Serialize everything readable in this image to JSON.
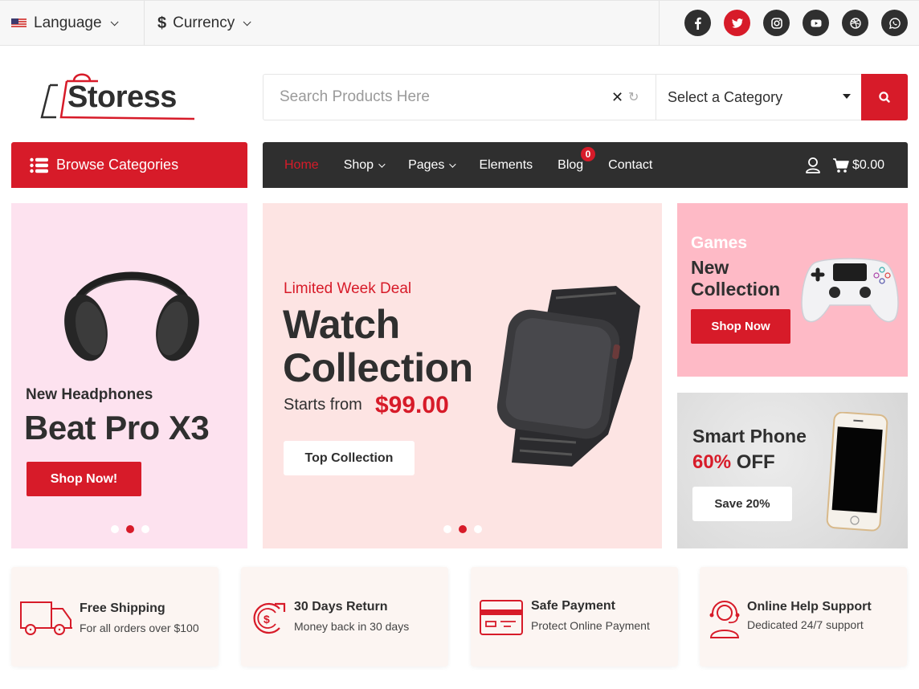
{
  "topbar": {
    "language_label": "Language",
    "currency_label": "Currency",
    "currency_symbol": "$",
    "socials": [
      {
        "name": "facebook",
        "icon": "facebook-icon"
      },
      {
        "name": "twitter",
        "icon": "twitter-icon",
        "active": true
      },
      {
        "name": "instagram",
        "icon": "instagram-icon"
      },
      {
        "name": "youtube",
        "icon": "youtube-icon"
      },
      {
        "name": "dribbble",
        "icon": "dribbble-icon"
      },
      {
        "name": "whatsapp",
        "icon": "whatsapp-icon"
      }
    ]
  },
  "header": {
    "logo_text": "Storess",
    "search": {
      "placeholder": "Search Products Here",
      "value": "",
      "clear_glyph": "✕",
      "refresh_glyph": "↻"
    },
    "category_select": {
      "selected": "Select a Category"
    }
  },
  "nav": {
    "browse_label": "Browse Categories",
    "links": [
      {
        "label": "Home",
        "active": true,
        "dropdown": false
      },
      {
        "label": "Shop",
        "active": false,
        "dropdown": true
      },
      {
        "label": "Pages",
        "active": false,
        "dropdown": true
      },
      {
        "label": "Elements",
        "active": false,
        "dropdown": false
      },
      {
        "label": "Blog",
        "active": false,
        "dropdown": false
      },
      {
        "label": "Contact",
        "active": false,
        "dropdown": false
      }
    ],
    "cart_count": "0",
    "cart_total": "$0.00"
  },
  "banners": {
    "left": {
      "subtitle": "New Headphones",
      "title": "Beat Pro X3",
      "button": "Shop Now!",
      "slides": 3,
      "active_slide": 2
    },
    "middle": {
      "subtitle": "Limited Week Deal",
      "title_line1": "Watch",
      "title_line2": "Collection",
      "price_prefix": "Starts from",
      "price": "$99.00",
      "button": "Top Collection",
      "slides": 3,
      "active_slide": 2
    },
    "top_right": {
      "subtitle": "Games",
      "title_line1": "New",
      "title_line2": "Collection",
      "button": "Shop Now"
    },
    "bottom_right": {
      "title": "Smart Phone",
      "discount": "60%",
      "discount_suffix": "OFF",
      "button": "Save 20%"
    }
  },
  "features": [
    {
      "title": "Free Shipping",
      "desc": "For all orders over $100",
      "icon": "truck-icon"
    },
    {
      "title": "30 Days Return",
      "desc": "Money back in 30 days",
      "icon": "return-icon"
    },
    {
      "title": "Safe Payment",
      "desc": "Protect Online Payment",
      "icon": "credit-card-icon"
    },
    {
      "title": "Online Help Support",
      "desc": "Dedicated 24/7 support",
      "icon": "headset-icon"
    }
  ],
  "colors": {
    "accent": "#d71b29",
    "dark": "#2f2f2f",
    "left_banner_bg": "#fde2ef",
    "middle_banner_bg": "#fde4e3",
    "top_right_banner_bg": "#febac6",
    "feature_bg": "#fcf5f2"
  }
}
